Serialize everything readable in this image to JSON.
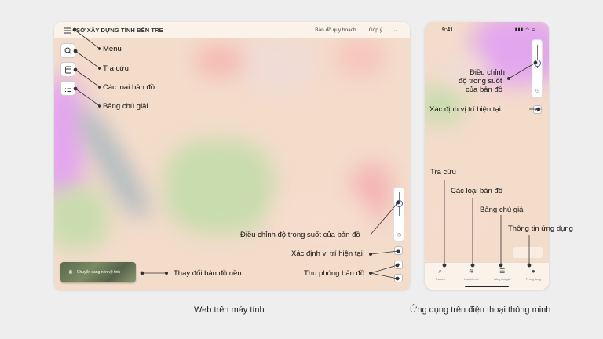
{
  "desktop": {
    "header_title": "SỞ XÂY DỰNG TỈNH BẾN TRE",
    "nav_link_1": "Bản đồ quy hoạch",
    "nav_link_2": "Góp ý",
    "basemap_button_label": "Chuyển sang nền vệ tinh",
    "zoom_in": "+",
    "zoom_out": "−"
  },
  "annotations_desktop": {
    "menu": "Menu",
    "search": "Tra cứu",
    "map_types": "Các loại bản đồ",
    "legend": "Bảng chú giải",
    "opacity": "Điều chỉnh độ trong suốt của bản đồ",
    "locate": "Xác định vị trí hiện tại",
    "zoom": "Thu phóng bản đồ",
    "basemap": "Thay đổi bản đồ nền"
  },
  "phone": {
    "time": "9:41",
    "tabs": [
      {
        "icon": "search-icon",
        "label": "Tra cứu"
      },
      {
        "icon": "layers-icon",
        "label": "Loại bản đồ"
      },
      {
        "icon": "legend-icon",
        "label": "Bảng chú giải"
      },
      {
        "icon": "info-icon",
        "label": "Tt ứng dụng"
      }
    ]
  },
  "annotations_phone": {
    "opacity_line1": "Điều chỉnh",
    "opacity_line2": "độ trong suốt",
    "opacity_line3": "của bản đồ",
    "locate": "Xác định vị trí hiện tại",
    "search": "Tra cứu",
    "map_types": "Các loại bản đồ",
    "legend": "Bảng chú giải",
    "app_info": "Thông tin ứng dụng"
  },
  "captions": {
    "desktop": "Web trên máy tính",
    "phone": "Ứng dụng trên điện thoại thông minh"
  },
  "colors": {
    "map_base": "#f4dccb",
    "accent_blue": "#3d5bd4",
    "zone_green": "#c9dcae",
    "zone_purple": "#e2a6ee",
    "zone_red": "#f1a3a3"
  }
}
